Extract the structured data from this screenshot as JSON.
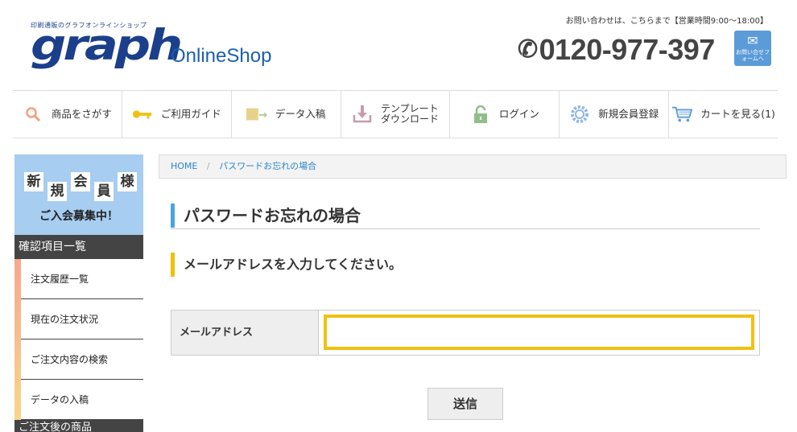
{
  "header": {
    "logo_tagline": "印刷通販のグラフオンラインショップ",
    "logo_main": "graph",
    "logo_sub": "OnlineShop",
    "contact_note": "お問い合わせは、こちらまで【営業時間9:00〜18:00】",
    "phone": "0120-977-397",
    "mail_button_text": "お問い合せフォームへ"
  },
  "nav": [
    {
      "label": "商品をさがす",
      "icon": "search-icon"
    },
    {
      "label": "ご利用ガイド",
      "icon": "key-icon"
    },
    {
      "label": "データ入稿",
      "icon": "upload-icon"
    },
    {
      "label": "テンプレート\nダウンロード",
      "icon": "download-icon"
    },
    {
      "label": "ログイン",
      "icon": "lock-icon"
    },
    {
      "label": "新規会員登録",
      "icon": "gear-icon"
    },
    {
      "label": "カートを見る(1)",
      "icon": "cart-icon"
    }
  ],
  "sidebar": {
    "promo_chars": [
      "新",
      "規",
      "会",
      "員",
      "様"
    ],
    "promo_sub": "ご入会募集中！",
    "section_title": "確認項目一覧",
    "items": [
      "注文履歴一覧",
      "現在の注文状況",
      "ご注文内容の検索",
      "データの入稿"
    ],
    "next_section": "ご注文後の商品"
  },
  "breadcrumb": {
    "home": "HOME",
    "sep": "/",
    "current": "パスワードお忘れの場合"
  },
  "main": {
    "title": "パスワードお忘れの場合",
    "subtitle": "メールアドレスを入力してください。",
    "field_label": "メールアドレス",
    "field_value": "",
    "submit": "送信"
  },
  "colors": {
    "brand": "#1b3f8b",
    "title_bar": "#4aa3e8",
    "sub_bar": "#f0c000",
    "input_border": "#f2c010"
  }
}
